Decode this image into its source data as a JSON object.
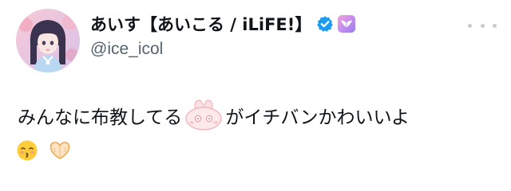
{
  "tweet": {
    "author": {
      "display_name": "あいす【あいこる / iLiFE!】",
      "handle": "@ice_icol",
      "avatar": "avatar-photo",
      "verified": true
    },
    "body": {
      "text_before_emoji": "みんなに布教してる",
      "text_after_emoji": "がイチバンかわいいよ",
      "inline_emoji": "pink-bunny-mascot-icon",
      "trailing_emojis": [
        "kissing-face-icon",
        "heart-hands-icon"
      ]
    },
    "more_icon": "more-dots-icon"
  },
  "colors": {
    "text": "#0f1419",
    "handle": "#536471",
    "verified_blue": "#1d9bf0",
    "affiliate_pink": "#e9a0e6",
    "more_dots": "#c8ccd0"
  }
}
